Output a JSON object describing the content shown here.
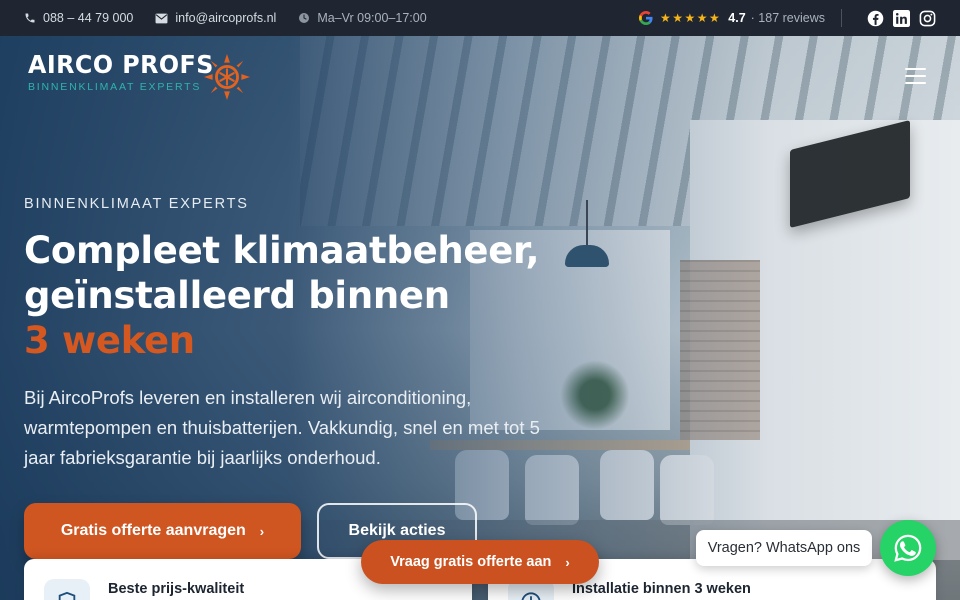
{
  "topbar": {
    "phone": "088 – 44 79 000",
    "email": "info@aircoprofs.nl",
    "hours": "Ma–Vr 09:00–17:00",
    "stars": "★★★★★",
    "rating": "4.7",
    "reviews": "· 187 reviews",
    "social": [
      "facebook-icon",
      "linkedin-icon",
      "instagram-icon"
    ]
  },
  "logo": {
    "wordmark": "AIRCO PROFS",
    "tagline": "BINNENKLIMAAT EXPERTS"
  },
  "hero": {
    "eyebrow": "BINNENKLIMAAT EXPERTS",
    "title_line1": "Compleet klimaatbeheer,",
    "title_line2": "geïnstalleerd binnen",
    "title_accent": "3 weken",
    "lead": "Bij AircoProfs leveren en installeren wij airconditioning, warmtepompen en thuisbatterijen. Vakkundig, snel en met tot 5 jaar fabrieksgarantie bij jaarlijks onderhoud."
  },
  "buttons": {
    "primary": "Gratis offerte aanvragen",
    "secondary": "Bekijk acties",
    "floating": "Vraag gratis offerte aan",
    "chevron": "›"
  },
  "whatsapp": {
    "bubble": "Vragen? WhatsApp ons"
  },
  "features": [
    {
      "title": "Beste prijs-kwaliteit",
      "icon": "shield-icon"
    },
    {
      "title": "Installatie binnen 3 weken",
      "icon": "clock-icon"
    }
  ],
  "colors": {
    "accent": "#cf5521",
    "topbar": "#1f2631",
    "whatsapp": "#25d366",
    "star": "#f6b41b",
    "tagline": "#2fb3ad"
  }
}
